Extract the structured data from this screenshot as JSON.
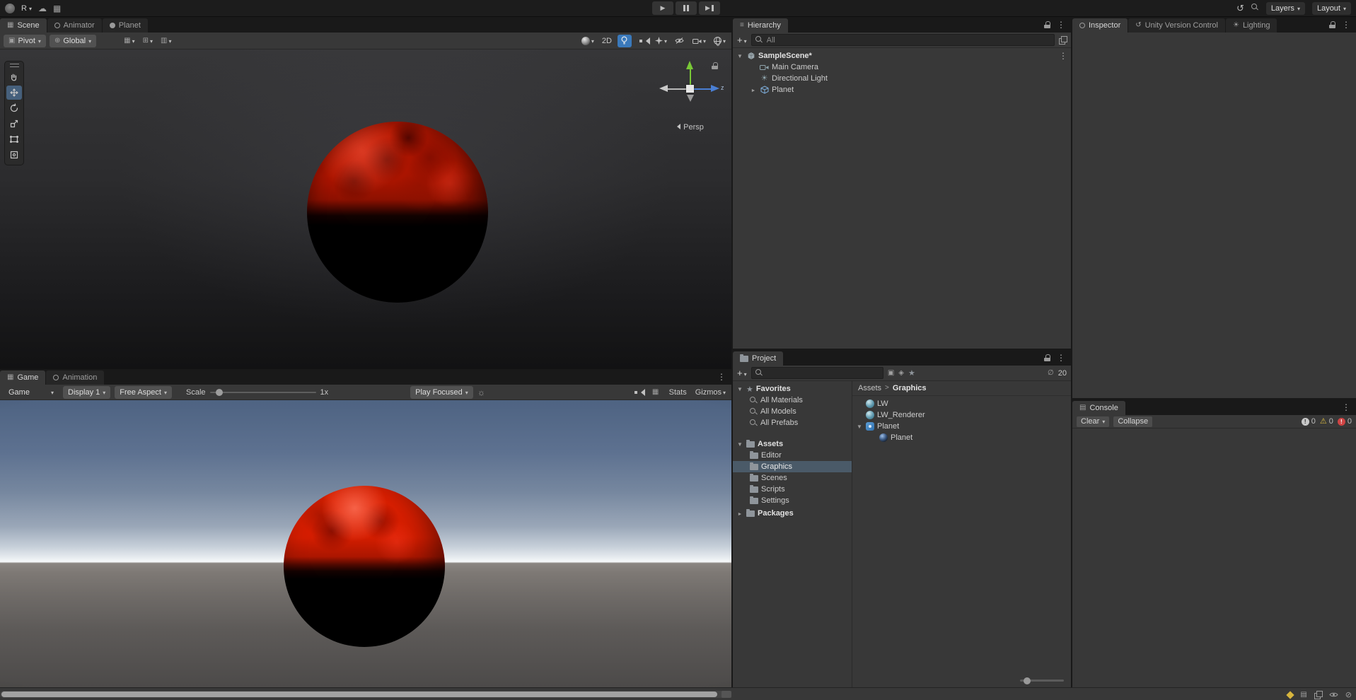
{
  "colors": {
    "panel_bg": "#383838",
    "tab_well": "#191919",
    "accent_blue": "#3a79bb",
    "selection": "#4a5a68",
    "planet_red": "#c11800",
    "sky_top": "#4e6382"
  },
  "icons": {
    "caret_down": "▾",
    "tree_expanded": "▼",
    "tree_collapsed": "►",
    "kebab_menu": "⋮",
    "cloud": "☁",
    "grid": "▦",
    "pivot": "▣",
    "globe": "⊕",
    "snap": "⊞",
    "move_snap": "▥",
    "undo_history": "↺",
    "directional_light": "☀",
    "hierarchy_list": "≡",
    "play": "▶",
    "hidden_eye": "∅",
    "warning": "⚠",
    "burst": "☼",
    "rows": "▤",
    "label_filter": "◈",
    "favorite_star": "★",
    "blocked": "⊘"
  },
  "topbar": {
    "account_initial": "R",
    "layers_button": "Layers",
    "layout_button": "Layout"
  },
  "scene": {
    "tabs": [
      {
        "label": "Scene"
      },
      {
        "label": "Animator"
      },
      {
        "label": "Planet"
      }
    ],
    "toolbar": {
      "pivot_button": "Pivot",
      "global_button": "Global",
      "two_d_button": "2D"
    },
    "gizmo": {
      "persp_label": "Persp",
      "z_axis_label": "z"
    }
  },
  "game": {
    "tabs": [
      {
        "label": "Game"
      },
      {
        "label": "Animation"
      }
    ],
    "toolbar": {
      "mode_button": "Game",
      "display_button": "Display 1",
      "aspect_button": "Free Aspect",
      "scale_label": "Scale",
      "scale_value": "1x",
      "play_focused_button": "Play Focused",
      "stats_button": "Stats",
      "gizmos_button": "Gizmos"
    }
  },
  "hierarchy": {
    "tab_label": "Hierarchy",
    "search_placeholder": "All",
    "items": [
      {
        "label": "SampleScene*"
      },
      {
        "label": "Main Camera"
      },
      {
        "label": "Directional Light"
      },
      {
        "label": "Planet"
      }
    ]
  },
  "project": {
    "tab_label": "Project",
    "favorites_label": "Favorites",
    "favorites": [
      {
        "label": "All Materials"
      },
      {
        "label": "All Models"
      },
      {
        "label": "All Prefabs"
      }
    ],
    "assets_label": "Assets",
    "folders": [
      {
        "label": "Editor"
      },
      {
        "label": "Graphics"
      },
      {
        "label": "Scenes"
      },
      {
        "label": "Scripts"
      },
      {
        "label": "Settings"
      }
    ],
    "packages_label": "Packages",
    "breadcrumb": {
      "root": "Assets",
      "separator": ">",
      "current": "Graphics"
    },
    "files": [
      {
        "label": "LW"
      },
      {
        "label": "LW_Renderer"
      },
      {
        "label": "Planet"
      },
      {
        "label": "Planet"
      }
    ],
    "hidden_count": "20"
  },
  "inspector": {
    "tabs": [
      {
        "label": "Inspector"
      },
      {
        "label": "Unity Version Control"
      },
      {
        "label": "Lighting"
      }
    ]
  },
  "console": {
    "tab_label": "Console",
    "clear_button": "Clear",
    "collapse_button": "Collapse",
    "info_count": "0",
    "warning_count": "0",
    "error_count": "0"
  }
}
